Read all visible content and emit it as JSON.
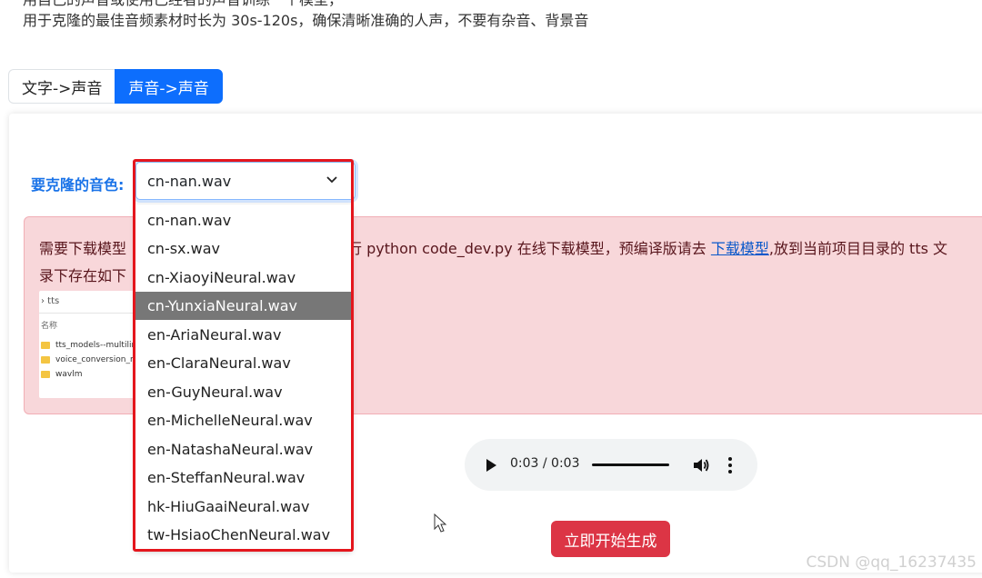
{
  "notes": {
    "partial_line": "用自己的声音或使用已经者的声音训练一个模型，",
    "main_line": "用于克隆的最佳音频素材时长为 30s-120s，确保清晰准确的人声，不要有杂音、背景音"
  },
  "tabs": [
    {
      "label": "文字->声音",
      "active": false
    },
    {
      "label": "声音->声音",
      "active": true
    }
  ],
  "voice_select": {
    "label": "要克隆的音色:",
    "value": "cn-nan.wav",
    "options": [
      "cn-nan.wav",
      "cn-sx.wav",
      "cn-XiaoyiNeural.wav",
      "cn-YunxiaNeural.wav",
      "en-AriaNeural.wav",
      "en-ClaraNeural.wav",
      "en-GuyNeural.wav",
      "en-MichelleNeural.wav",
      "en-NatashaNeural.wav",
      "en-SteffanNeural.wav",
      "hk-HiuGaaiNeural.wav",
      "tw-HsiaoChenNeural.wav"
    ],
    "highlighted_option": "cn-YunxiaNeural.wav"
  },
  "alert": {
    "text_before": "需要下载模型",
    "text_mid": "执行 python code_dev.py 在线下载模型，预编译版请去 ",
    "link": "下载模型",
    "text_after": ",放到当前项目目录的 tts 文",
    "line2": "录下存在如下"
  },
  "folder_screenshot": {
    "breadcrumb": "›  tts",
    "column": "名称",
    "rows": [
      "tts_models--multilin",
      "voice_conversion_m",
      "wavlm"
    ]
  },
  "audio": {
    "time": "0:03 / 0:03",
    "play_icon": "play-icon",
    "volume_icon": "volume-icon",
    "more_icon": "more-vertical-icon"
  },
  "generate_button": "立即开始生成",
  "watermark": "CSDN @qq_16237435",
  "colors": {
    "accent": "#0d6efd",
    "danger": "#dc3545",
    "alert_bg": "#f8d7da",
    "annotation_red": "#e4161d",
    "selected_option_bg": "#777777"
  }
}
